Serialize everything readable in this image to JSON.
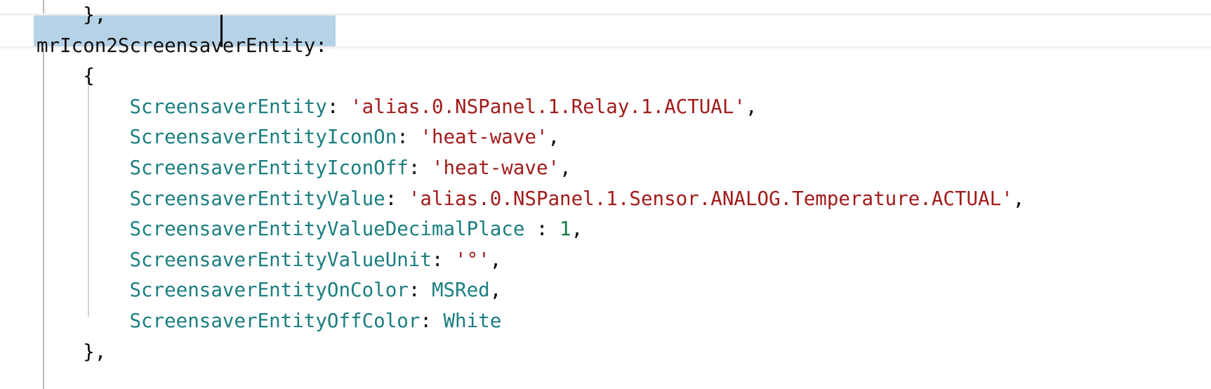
{
  "editor": {
    "language": "javascript",
    "font_size_px": 27,
    "colors": {
      "background": "#ffffff",
      "property_name": "#1b7e80",
      "string": "#a21b1b",
      "number": "#0f7a3d",
      "punctuation": "#000000",
      "search_highlight": "#b6d2e6",
      "indent_guide": "#b9b9b9",
      "indent_guide_inner": "#d2d2d2",
      "caret": "#000000"
    },
    "search_match": {
      "text": "mrIcon2ScreensaverEntity",
      "caret_after": "mrIcon2Screensa"
    }
  },
  "lines": [
    {
      "id": "line-close-brace-prev",
      "indent": 2,
      "tokens": [
        {
          "t": "punc",
          "v": "},"
        }
      ]
    },
    {
      "id": "line-property-key-highlighted",
      "indent": 0,
      "highlighted": true,
      "tokens": [
        {
          "t": "matchtext",
          "v": "mrIcon2ScreensaverEntity"
        },
        {
          "t": "punc",
          "v": ":"
        }
      ]
    },
    {
      "id": "line-open-brace",
      "indent": 2,
      "tokens": [
        {
          "t": "punc",
          "v": "{"
        }
      ]
    },
    {
      "id": "line-screensaver-entity",
      "indent": 4,
      "tokens": [
        {
          "t": "key",
          "v": "ScreensaverEntity"
        },
        {
          "t": "punc",
          "v": ": "
        },
        {
          "t": "str",
          "v": "'alias.0.NSPanel.1.Relay.1.ACTUAL'"
        },
        {
          "t": "punc",
          "v": ","
        }
      ]
    },
    {
      "id": "line-screensaver-entity-icon-on",
      "indent": 4,
      "tokens": [
        {
          "t": "key",
          "v": "ScreensaverEntityIconOn"
        },
        {
          "t": "punc",
          "v": ": "
        },
        {
          "t": "str",
          "v": "'heat-wave'"
        },
        {
          "t": "punc",
          "v": ","
        }
      ]
    },
    {
      "id": "line-screensaver-entity-icon-off",
      "indent": 4,
      "tokens": [
        {
          "t": "key",
          "v": "ScreensaverEntityIconOff"
        },
        {
          "t": "punc",
          "v": ": "
        },
        {
          "t": "str",
          "v": "'heat-wave'"
        },
        {
          "t": "punc",
          "v": ","
        }
      ]
    },
    {
      "id": "line-screensaver-entity-value",
      "indent": 4,
      "tokens": [
        {
          "t": "key",
          "v": "ScreensaverEntityValue"
        },
        {
          "t": "punc",
          "v": ": "
        },
        {
          "t": "str",
          "v": "'alias.0.NSPanel.1.Sensor.ANALOG.Temperature.ACTUAL'"
        },
        {
          "t": "punc",
          "v": ","
        }
      ]
    },
    {
      "id": "line-screensaver-entity-value-decimal-place",
      "indent": 4,
      "tokens": [
        {
          "t": "key",
          "v": "ScreensaverEntityValueDecimalPlace"
        },
        {
          "t": "punc",
          "v": " : "
        },
        {
          "t": "num",
          "v": "1"
        },
        {
          "t": "punc",
          "v": ","
        }
      ]
    },
    {
      "id": "line-screensaver-entity-value-unit",
      "indent": 4,
      "tokens": [
        {
          "t": "key",
          "v": "ScreensaverEntityValueUnit"
        },
        {
          "t": "punc",
          "v": ": "
        },
        {
          "t": "str",
          "v": "'°'"
        },
        {
          "t": "punc",
          "v": ","
        }
      ]
    },
    {
      "id": "line-screensaver-entity-on-color",
      "indent": 4,
      "tokens": [
        {
          "t": "key",
          "v": "ScreensaverEntityOnColor"
        },
        {
          "t": "punc",
          "v": ": "
        },
        {
          "t": "ident",
          "v": "MSRed"
        },
        {
          "t": "punc",
          "v": ","
        }
      ]
    },
    {
      "id": "line-screensaver-entity-off-color",
      "indent": 4,
      "tokens": [
        {
          "t": "key",
          "v": "ScreensaverEntityOffColor"
        },
        {
          "t": "punc",
          "v": ": "
        },
        {
          "t": "ident",
          "v": "White"
        }
      ]
    },
    {
      "id": "line-close-brace",
      "indent": 2,
      "tokens": [
        {
          "t": "punc",
          "v": "},"
        }
      ]
    }
  ]
}
